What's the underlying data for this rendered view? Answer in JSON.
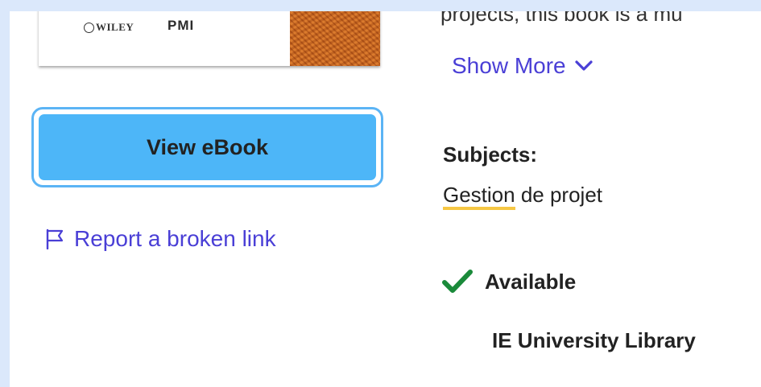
{
  "cover": {
    "publisher_logo": "WILEY",
    "partner_logo": "PMI"
  },
  "actions": {
    "view_ebook_label": "View eBook",
    "report_link_label": "Report a broken link",
    "report_icon": "flag-icon"
  },
  "description": {
    "fragment_text": "projects, this book is a mu",
    "show_more_label": "Show More",
    "show_more_icon": "chevron-down-icon"
  },
  "subjects": {
    "heading": "Subjects:",
    "items": [
      {
        "linked_term": "Gestion",
        "rest": " de projet"
      }
    ]
  },
  "availability": {
    "status_icon": "check-icon",
    "status_label": "Available",
    "status_color": "#1a8a3a",
    "location": "IE University Library"
  },
  "colors": {
    "page_background": "#dbe8fb",
    "button_fill": "#4db6f8",
    "button_focus_ring": "#5bb4f5",
    "link_color": "#4a3fd6",
    "subject_underline": "#f6c744"
  }
}
